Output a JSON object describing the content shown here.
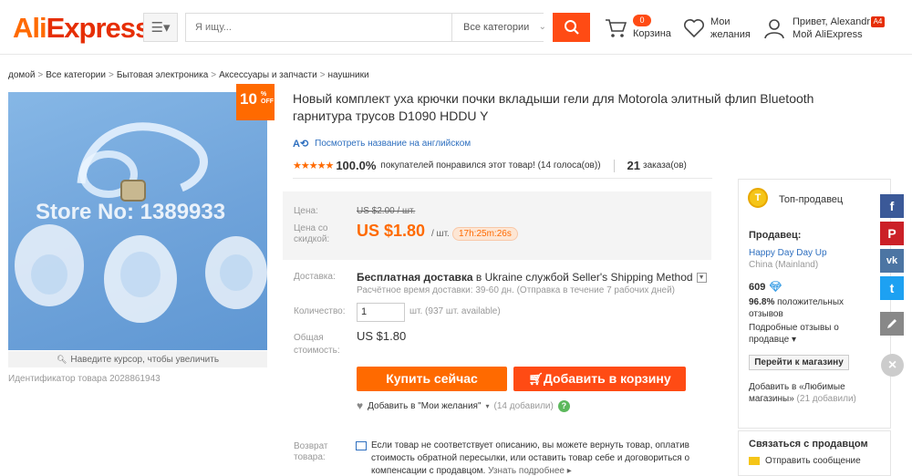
{
  "header": {
    "logo_ali": "Ali",
    "logo_express": "Express",
    "search_placeholder": "Я ищу...",
    "category_select": "Все категории",
    "cart_count": "0",
    "cart_label": "Корзина",
    "wishlist_label_1": "Мои",
    "wishlist_label_2": "желания",
    "user_greeting": "Привет, Alexandr",
    "user_account": "Мой AliExpress",
    "user_lang": "A4"
  },
  "breadcrumb": [
    "домой",
    "Все категории",
    "Бытовая электроника",
    "Аксессуары и запчасти",
    "наушники"
  ],
  "product": {
    "watermark": "Store No: 1389933",
    "discount_pct": "10",
    "discount_sym": "%",
    "discount_off": "OFF",
    "zoom_hint": "Наведите курсор, чтобы увеличить",
    "id_text": "Идентификатор товара 2028861943",
    "title": "Новый комплект уха крючки почки вкладыши гели для Motorola элитный флип Bluetooth гарнитура трусов D1090 HDDU Y",
    "translate_link": "Посмотреть название на английском",
    "stars": "★★★★★",
    "rating_pct": "100.0%",
    "rating_text": "покупателей понравился этот товар! (14 голоса(ов))",
    "orders_count": "21",
    "orders_label": "заказа(ов)"
  },
  "price": {
    "orig_label": "Цена:",
    "orig_value": "US $2.00 / шт.",
    "disc_label": "Цена со скидкой:",
    "disc_value": "US $1.80",
    "unit": "/ шт.",
    "timer": "17h:25m:26s"
  },
  "shipping": {
    "label": "Доставка:",
    "free": "Бесплатная доставка",
    "rest": " в Ukraine службой Seller's Shipping Method",
    "sub": "Расчётное время доставки: 39-60 дн. (Отправка в течение 7 рабочих дней)"
  },
  "quantity": {
    "label": "Количество:",
    "value": "1",
    "avail": "шт. (937 шт. available)"
  },
  "total": {
    "label": "Общая стоимость:",
    "value": "US $1.80"
  },
  "actions": {
    "buy_now": "Купить сейчас",
    "add_to_cart": "Добавить в корзину",
    "add_wish": "Добавить в \"Мои желания\"",
    "wish_count": "(14 добавили)",
    "help": "?"
  },
  "return_policy": {
    "label": "Возврат товара:",
    "text": "Если товар не соответствует описанию, вы можете вернуть товар, оплатив стоимость обратной пересылки, или оставить товар себе и договориться о компенсации с продавцом.",
    "more": "Узнать подробнее ▸"
  },
  "seller": {
    "badge_letter": "T",
    "top_seller": "Топ-продавец",
    "header": "Продавец:",
    "name": "Happy Day Day Up",
    "country": "China (Mainland)",
    "score": "609",
    "pos_pct": "96.8%",
    "pos_text": " положительных отзывов",
    "similar": "Подробные отзывы о продавце ▾",
    "store_button": "Перейти к магазину",
    "fav_text": "Добавить в «Любимые магазины»",
    "fav_count": "(21 добавили)",
    "contact_header": "Связаться с продавцом",
    "contact_msg": "Отправить сообщение"
  },
  "social": {
    "facebook": "f",
    "pinterest": "P",
    "vk": "vk",
    "twitter": "t",
    "close": "×"
  },
  "colors": {
    "brand_orange": "#ff6a00",
    "brand_red": "#ff4b14",
    "link_blue": "#2e6fbf",
    "facebook": "#3b5998",
    "pinterest": "#cb2027",
    "vk": "#4c75a3",
    "twitter": "#1da1f2"
  }
}
